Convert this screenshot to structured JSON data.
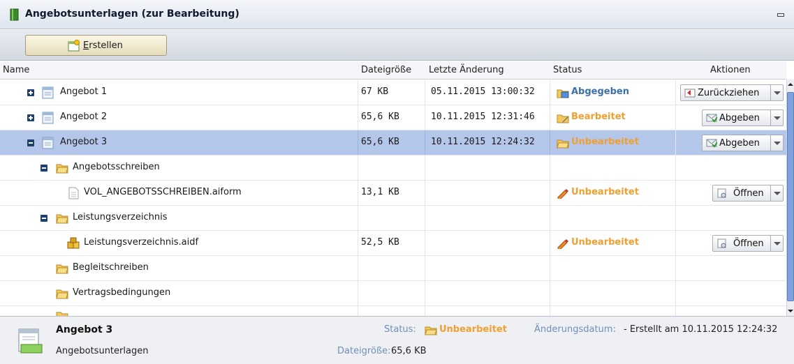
{
  "window": {
    "title": "Angebotsunterlagen (zur Bearbeitung)"
  },
  "toolbar": {
    "create_label": "Erstellen"
  },
  "columns": {
    "name": "Name",
    "size": "Dateigröße",
    "modified": "Letzte Änderung",
    "status": "Status",
    "actions": "Aktionen"
  },
  "rows": [
    {
      "name": "Angebot 1",
      "size": "67 KB",
      "modified": "05.11.2015 13:00:32",
      "status": "Abgegeben",
      "action": "Zurückziehen"
    },
    {
      "name": "Angebot 2",
      "size": "65,6 KB",
      "modified": "10.11.2015 12:31:46",
      "status": "Bearbeitet",
      "action": "Abgeben"
    },
    {
      "name": "Angebot 3",
      "size": "65,6 KB",
      "modified": "10.11.2015 12:24:32",
      "status": "Unbearbeitet",
      "action": "Abgeben"
    },
    {
      "name": "Angebotsschreiben",
      "size": "",
      "modified": "",
      "status": "",
      "action": ""
    },
    {
      "name": "VOL_ANGEBOTSSCHREIBEN.aiform",
      "size": "13,1 KB",
      "modified": "",
      "status": "Unbearbeitet",
      "action": "Öffnen"
    },
    {
      "name": "Leistungsverzeichnis",
      "size": "",
      "modified": "",
      "status": "",
      "action": ""
    },
    {
      "name": "Leistungsverzeichnis.aidf",
      "size": "52,5 KB",
      "modified": "",
      "status": "Unbearbeitet",
      "action": "Öffnen"
    },
    {
      "name": "Begleitschreiben",
      "size": "",
      "modified": "",
      "status": "",
      "action": ""
    },
    {
      "name": "Vertragsbedingungen",
      "size": "",
      "modified": "",
      "status": "",
      "action": ""
    }
  ],
  "footer": {
    "name": "Angebot 3",
    "subtitle": "Angebotsunterlagen",
    "status_label": "Status:",
    "status_value": "Unbearbeitet",
    "date_label": "Änderungsdatum:",
    "date_value": "- Erstellt am 10.11.2015 12:24:32",
    "size_label": "Dateigröße:",
    "size_value": "65,6 KB"
  },
  "colors": {
    "selected_row": "#b4c6ea",
    "status_blue": "#3d6fa8",
    "status_orange": "#f0a030"
  }
}
